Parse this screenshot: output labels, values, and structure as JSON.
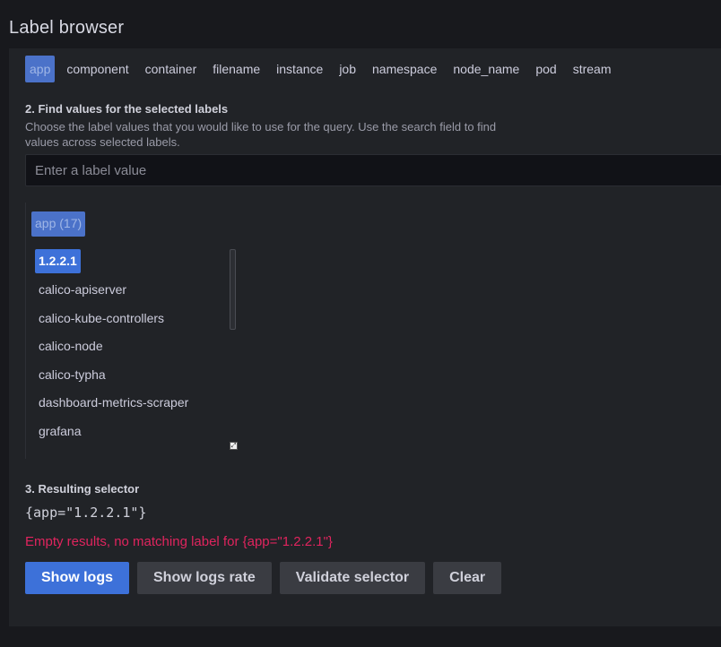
{
  "page": {
    "title": "Label browser"
  },
  "labels": [
    {
      "label": "app",
      "selected": true
    },
    {
      "label": "component",
      "selected": false
    },
    {
      "label": "container",
      "selected": false
    },
    {
      "label": "filename",
      "selected": false
    },
    {
      "label": "instance",
      "selected": false
    },
    {
      "label": "job",
      "selected": false
    },
    {
      "label": "namespace",
      "selected": false
    },
    {
      "label": "node_name",
      "selected": false
    },
    {
      "label": "pod",
      "selected": false
    },
    {
      "label": "stream",
      "selected": false
    }
  ],
  "find_values": {
    "heading": "2. Find values for the selected labels",
    "description": "Choose the label values that you would like to use for the query. Use the search field to find values across selected labels.",
    "search_placeholder": "Enter a label value"
  },
  "value_list": {
    "header": "app (17)",
    "items": [
      {
        "label": "1.2.2.1",
        "selected": true
      },
      {
        "label": "calico-apiserver",
        "selected": false
      },
      {
        "label": "calico-kube-controllers",
        "selected": false
      },
      {
        "label": "calico-node",
        "selected": false
      },
      {
        "label": "calico-typha",
        "selected": false
      },
      {
        "label": "dashboard-metrics-scraper",
        "selected": false
      },
      {
        "label": "grafana",
        "selected": false
      }
    ]
  },
  "result": {
    "heading": "3. Resulting selector",
    "selector": "{app=\"1.2.2.1\"}",
    "error": "Empty results, no matching label for {app=\"1.2.2.1\"}"
  },
  "buttons": {
    "show_logs": "Show logs",
    "show_logs_rate": "Show logs rate",
    "validate": "Validate selector",
    "clear": "Clear"
  },
  "colors": {
    "accent": "#3d71d9",
    "error": "#e0245e",
    "background": "#18191d",
    "panel": "#212327"
  },
  "icons": {
    "resize": "resize-handle-icon"
  }
}
